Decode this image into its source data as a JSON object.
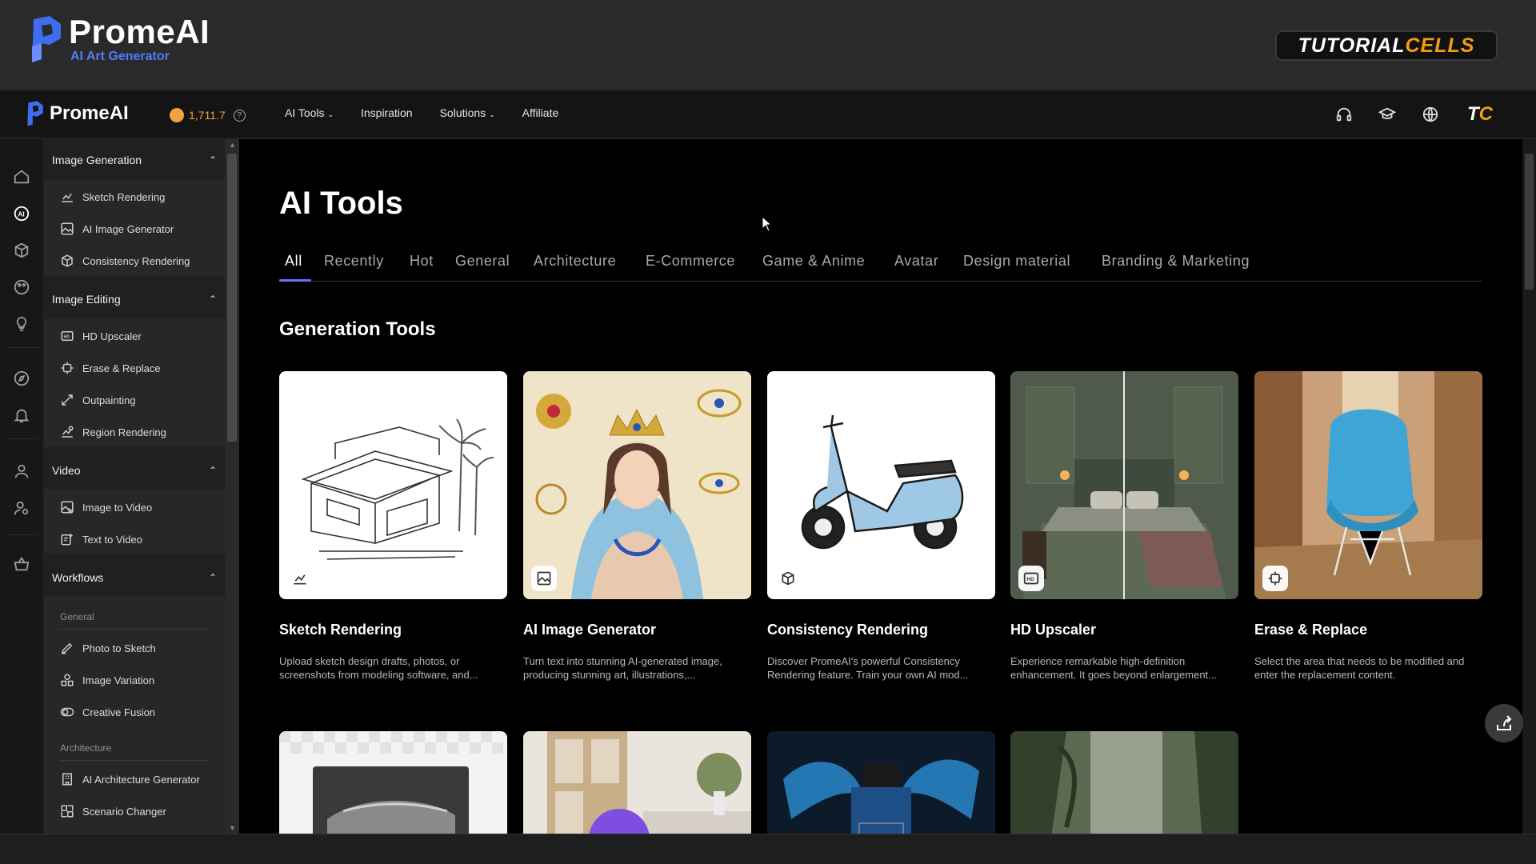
{
  "banner": {
    "logo_name": "PromeAI",
    "logo_sub": "AI Art Generator",
    "badge_part1": "TUTORIAL",
    "badge_part2": "CELLS"
  },
  "topnav": {
    "logo_name": "PromeAI",
    "credits": "1,711.7",
    "links": [
      "AI Tools",
      "Inspiration",
      "Solutions",
      "Affiliate"
    ],
    "avatar_part1": "T",
    "avatar_part2": "C"
  },
  "sidebar": {
    "image_generation": {
      "title": "Image Generation",
      "items": [
        "Sketch Rendering",
        "AI Image Generator",
        "Consistency Rendering"
      ]
    },
    "image_editing": {
      "title": "Image Editing",
      "items": [
        "HD Upscaler",
        "Erase & Replace",
        "Outpainting",
        "Region Rendering"
      ]
    },
    "video": {
      "title": "Video",
      "items": [
        "Image to Video",
        "Text to Video"
      ]
    },
    "workflows": {
      "title": "Workflows",
      "general_label": "General",
      "general_items": [
        "Photo to Sketch",
        "Image Variation",
        "Creative Fusion"
      ],
      "architecture_label": "Architecture",
      "architecture_items": [
        "AI Architecture Generator",
        "Scenario Changer"
      ]
    }
  },
  "main": {
    "title": "AI Tools",
    "tabs": [
      "All",
      "Recently",
      "Hot",
      "General",
      "Architecture",
      "E-Commerce",
      "Game & Anime",
      "Avatar",
      "Design material",
      "Branding & Marketing"
    ],
    "active_tab": "All",
    "section_title": "Generation Tools",
    "cards": [
      {
        "title": "Sketch Rendering",
        "desc": "Upload sketch design drafts, photos, or screenshots from modeling software, and...",
        "icon": "sketch-icon"
      },
      {
        "title": "AI Image Generator",
        "desc": "Turn text into stunning AI-generated image, producing stunning art, illustrations,...",
        "icon": "image-icon"
      },
      {
        "title": "Consistency Rendering",
        "desc": "Discover PromeAI's powerful Consistency Rendering feature. Train your own AI mod...",
        "icon": "cube-icon"
      },
      {
        "title": "HD Upscaler",
        "desc": "Experience remarkable high-definition enhancement. It goes beyond enlargement...",
        "icon": "hd-icon"
      },
      {
        "title": "Erase & Replace",
        "desc": "Select the area that needs to be modified and enter the replacement content.",
        "icon": "erase-icon"
      }
    ]
  },
  "colors": {
    "accent": "#6f6cff",
    "credits": "#f0a23b",
    "background": "#000000"
  }
}
